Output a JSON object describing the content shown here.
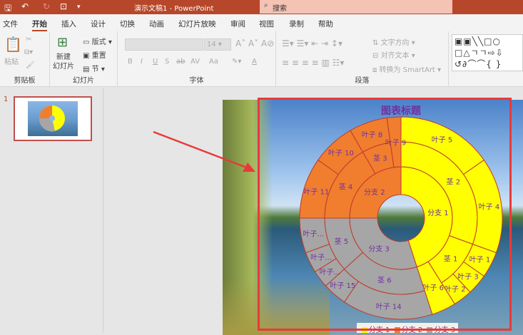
{
  "titlebar": {
    "title": "演示文稿1 - PowerPoint",
    "search_placeholder": "搜索",
    "qa_icons": [
      "save-icon",
      "undo-icon",
      "redo-icon",
      "present-icon",
      "customize-icon"
    ]
  },
  "tabs": [
    "文件",
    "开始",
    "插入",
    "设计",
    "切换",
    "动画",
    "幻灯片放映",
    "审阅",
    "视图",
    "录制",
    "帮助"
  ],
  "active_tab": "开始",
  "ribbon": {
    "clipboard": {
      "label": "剪贴板",
      "paste": "粘贴"
    },
    "slides": {
      "label": "幻灯片",
      "new_slide": "新建\n幻灯片",
      "layout": "版式",
      "reset": "重置",
      "section": "节"
    },
    "font": {
      "label": "字体",
      "size": "14",
      "buttons": [
        "B",
        "I",
        "U",
        "S",
        "ab",
        "AV",
        "Aa",
        "A"
      ]
    },
    "paragraph": {
      "label": "段落",
      "text_direction": "文字方向",
      "align_text": "对齐文本",
      "smartart": "转换为 SmartArt"
    }
  },
  "slide_panel": {
    "slide_number": "1"
  },
  "chart_data": {
    "type": "sunburst",
    "title": "图表标题",
    "legend": [
      {
        "name": "分支 1",
        "color": "#ffff00"
      },
      {
        "name": "分支 2",
        "color": "#f07e2e"
      },
      {
        "name": "分支 3",
        "color": "#a6a6a6"
      }
    ],
    "legend_position": "bottom",
    "tree": [
      {
        "name": "分支 1",
        "color": "#ffff00",
        "children": [
          {
            "name": "茎 2",
            "children": [
              {
                "name": "叶子 5",
                "value": 55
              },
              {
                "name": "叶子 4",
                "value": 55
              }
            ]
          },
          {
            "name": "茎 1",
            "children": [
              {
                "name": "叶子 1",
                "value": 15
              },
              {
                "name": "叶子 3",
                "value": 12
              },
              {
                "name": "叶子 2",
                "value": 11
              }
            ]
          },
          {
            "name": "叶子 6",
            "value": 14
          }
        ]
      },
      {
        "name": "分支 3",
        "color": "#a6a6a6",
        "children": [
          {
            "name": "茎 6",
            "children": [
              {
                "name": "叶子 14",
                "value": 52
              },
              {
                "name": "叶子 15",
                "value": 14
              }
            ]
          },
          {
            "name": "茎 5",
            "children": [
              {
                "name": "叶子…",
                "value": 10
              },
              {
                "name": "叶子…",
                "value": 12
              },
              {
                "name": "叶子…",
                "value": 20
              }
            ]
          }
        ]
      },
      {
        "name": "分支 2",
        "color": "#f07e2e",
        "children": [
          {
            "name": "茎 4",
            "children": [
              {
                "name": "叶子 11",
                "value": 35
              },
              {
                "name": "叶子 10",
                "value": 25
              }
            ]
          },
          {
            "name": "茎 3",
            "children": [
              {
                "name": "叶子 8",
                "value": 22
              }
            ]
          },
          {
            "name": "叶子 9",
            "value": 8
          }
        ]
      }
    ]
  }
}
